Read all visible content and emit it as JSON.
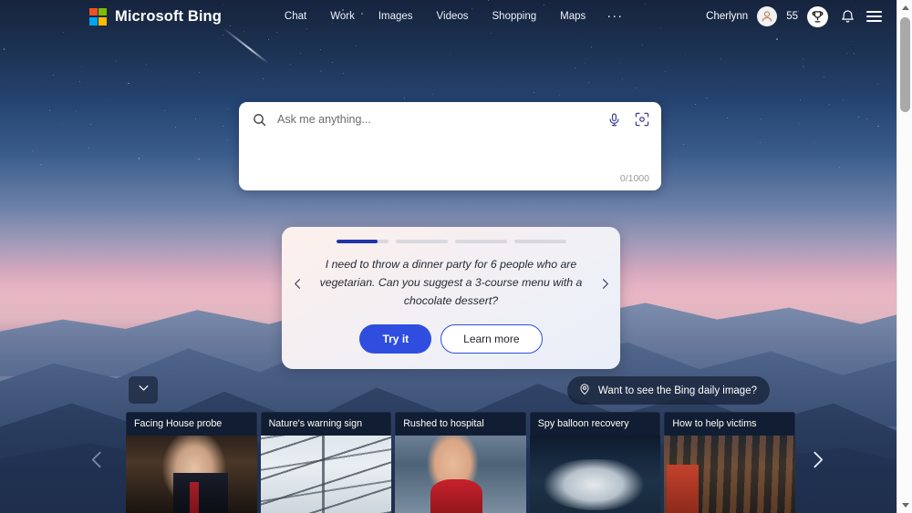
{
  "window": {
    "title": "Microsoft Bing"
  },
  "brand": {
    "name": "Microsoft Bing",
    "logo_icon": "microsoft-logo-icon"
  },
  "nav": {
    "links": [
      {
        "label": "Chat"
      },
      {
        "label": "Work"
      },
      {
        "label": "Images"
      },
      {
        "label": "Videos"
      },
      {
        "label": "Shopping"
      },
      {
        "label": "Maps"
      }
    ],
    "more_label": "···",
    "more_icon": "ellipsis-icon"
  },
  "account": {
    "username": "Cherlynn",
    "avatar_icon": "person-avatar-icon",
    "points": "55",
    "rewards_icon": "trophy-icon",
    "notifications_icon": "bell-icon",
    "menu_icon": "hamburger-menu-icon"
  },
  "search": {
    "placeholder": "Ask me anything...",
    "value": "",
    "counter": "0/1000",
    "search_icon": "search-icon",
    "mic_icon": "microphone-icon",
    "visual_search_icon": "visual-search-camera-icon"
  },
  "suggestion": {
    "prompt": "I need to throw a dinner party for 6 people who are vegetarian. Can you suggest a 3-course menu with a chocolate dessert?",
    "try_label": "Try it",
    "learn_label": "Learn more",
    "prev_icon": "chevron-left-icon",
    "next_icon": "chevron-right-icon",
    "progress": [
      80,
      0,
      0,
      0
    ],
    "accent_color": "#1f35a8",
    "primary_button_color": "#2f4ee0"
  },
  "daily_image": {
    "label": "Want to see the Bing daily image?",
    "pin_icon": "location-pin-icon"
  },
  "expand": {
    "icon": "chevron-down-icon"
  },
  "carousel": {
    "prev_icon": "chevron-left-icon",
    "next_icon": "chevron-right-icon",
    "cards": [
      {
        "title": "Facing House probe",
        "image_class": "img-congress"
      },
      {
        "title": "Nature's warning sign",
        "image_class": "img-wires"
      },
      {
        "title": "Rushed to hospital",
        "image_class": "img-hospital"
      },
      {
        "title": "Spy balloon recovery",
        "image_class": "img-balloon"
      },
      {
        "title": "How to help victims",
        "image_class": "img-crowd"
      }
    ]
  },
  "scrollbar": {
    "up_icon": "scroll-up-arrow-icon",
    "down_icon": "scroll-down-arrow-icon",
    "thumb_icon": "scrollbar-thumb"
  }
}
